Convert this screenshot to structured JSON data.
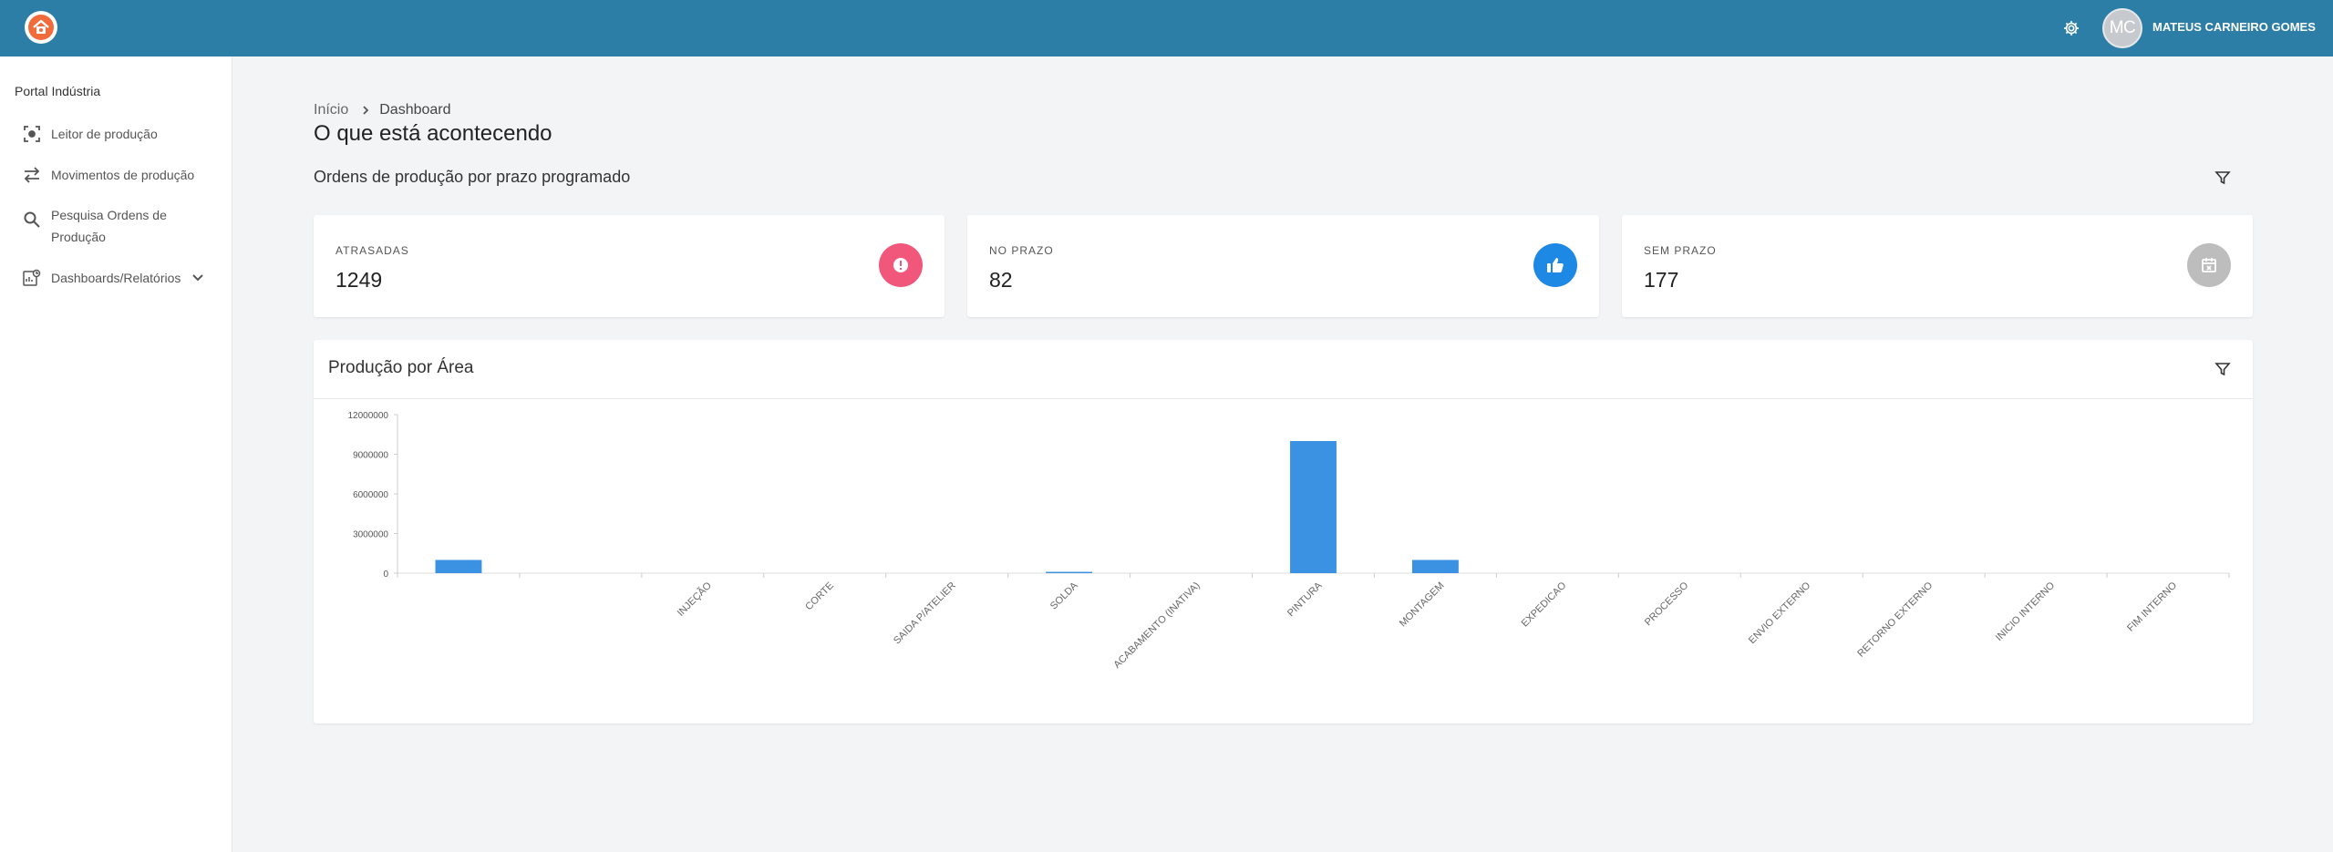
{
  "header": {
    "logo_icon": "home-logo-icon",
    "settings_icon": "gear-icon",
    "avatar_initials": "MC",
    "username": "MATEUS CARNEIRO GOMES"
  },
  "sidebar": {
    "title": "Portal Indústria",
    "items": [
      {
        "label": "Leitor de produção",
        "icon": "scanner-icon"
      },
      {
        "label": "Movimentos de produção",
        "icon": "swap-arrows-icon"
      },
      {
        "label": "Pesquisa Ordens de Produção",
        "icon": "search-icon"
      },
      {
        "label": "Dashboards/Relatórios",
        "icon": "dashboard-report-icon"
      }
    ]
  },
  "breadcrumb": {
    "home": "Início",
    "current": "Dashboard"
  },
  "page_title": "O que está acontecendo",
  "section_title": "Ordens de produção por prazo programado",
  "cards": [
    {
      "label": "ATRASADAS",
      "value": "1249",
      "icon": "alert-icon",
      "color": "#f0577a"
    },
    {
      "label": "NO PRAZO",
      "value": "82",
      "icon": "thumbs-up-icon",
      "color": "#1e88e5"
    },
    {
      "label": "SEM PRAZO",
      "value": "177",
      "icon": "calendar-icon",
      "color": "#bdbdbd"
    }
  ],
  "chart_card_title": "Produção por Área",
  "chart_data": {
    "type": "bar",
    "categories": [
      "",
      "",
      "INJEÇÃO",
      "CORTE",
      "SAIDA P/ATELIER",
      "SOLDA",
      "ACABAMENTO (INATIVA)",
      "PINTURA",
      "MONTAGEM",
      "EXPEDICAO",
      "PROCESSO",
      "ENVIO EXTERNO",
      "RETORNO EXTERNO",
      "INICIO INTERNO",
      "FIM INTERNO"
    ],
    "values": [
      1000000,
      0,
      0,
      0,
      0,
      100000,
      0,
      10000000,
      1000000,
      0,
      0,
      0,
      0,
      0,
      0
    ],
    "yticks": [
      "12000000",
      "9000000",
      "6000000",
      "3000000",
      "0"
    ],
    "ylim": [
      0,
      12000000
    ],
    "bar_color": "#3b92e3",
    "title": "",
    "xlabel": "",
    "ylabel": ""
  }
}
